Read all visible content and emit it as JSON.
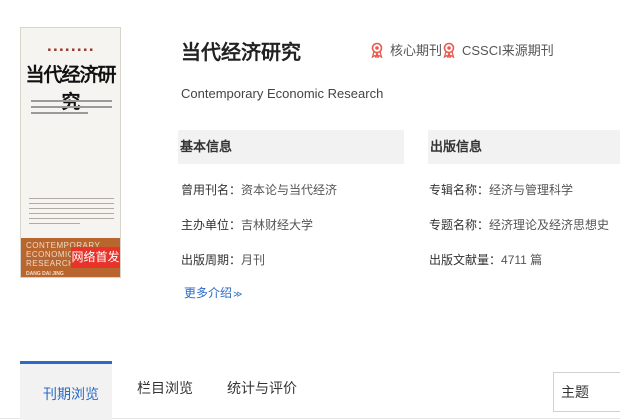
{
  "journal": {
    "title": "当代经济研究",
    "subtitle": "Contemporary Economic Research",
    "tags": {
      "core": "核心期刊",
      "cssci": "CSSCI来源期刊"
    }
  },
  "cover": {
    "title": "当代经济研究",
    "en": "CONTEMPORARY ECONOMIC RESEARCH",
    "pinyin": "DANG DAI JING",
    "badge": "网络首发"
  },
  "basic_info": {
    "heading": "基本信息",
    "rows": [
      {
        "label": "曾用刊名：",
        "value": "资本论与当代经济"
      },
      {
        "label": "主办单位：",
        "value": "吉林财经大学"
      },
      {
        "label": "出版周期：",
        "value": "月刊"
      }
    ]
  },
  "pub_info": {
    "heading": "出版信息",
    "rows": [
      {
        "label": "专辑名称：",
        "value": "经济与管理科学"
      },
      {
        "label": "专题名称：",
        "value": "经济理论及经济思想史"
      },
      {
        "label": "出版文献量：",
        "value": "4711 篇"
      }
    ]
  },
  "more_link": "更多介绍",
  "tabs": [
    {
      "label": "刊期浏览",
      "active": true
    },
    {
      "label": "栏目浏览",
      "active": false
    },
    {
      "label": "统计与评价",
      "active": false
    }
  ],
  "search_select": "主题",
  "colors": {
    "accent": "#2a6ac8",
    "badge": "#e8332a",
    "tag_icon": "#e85a4f"
  }
}
